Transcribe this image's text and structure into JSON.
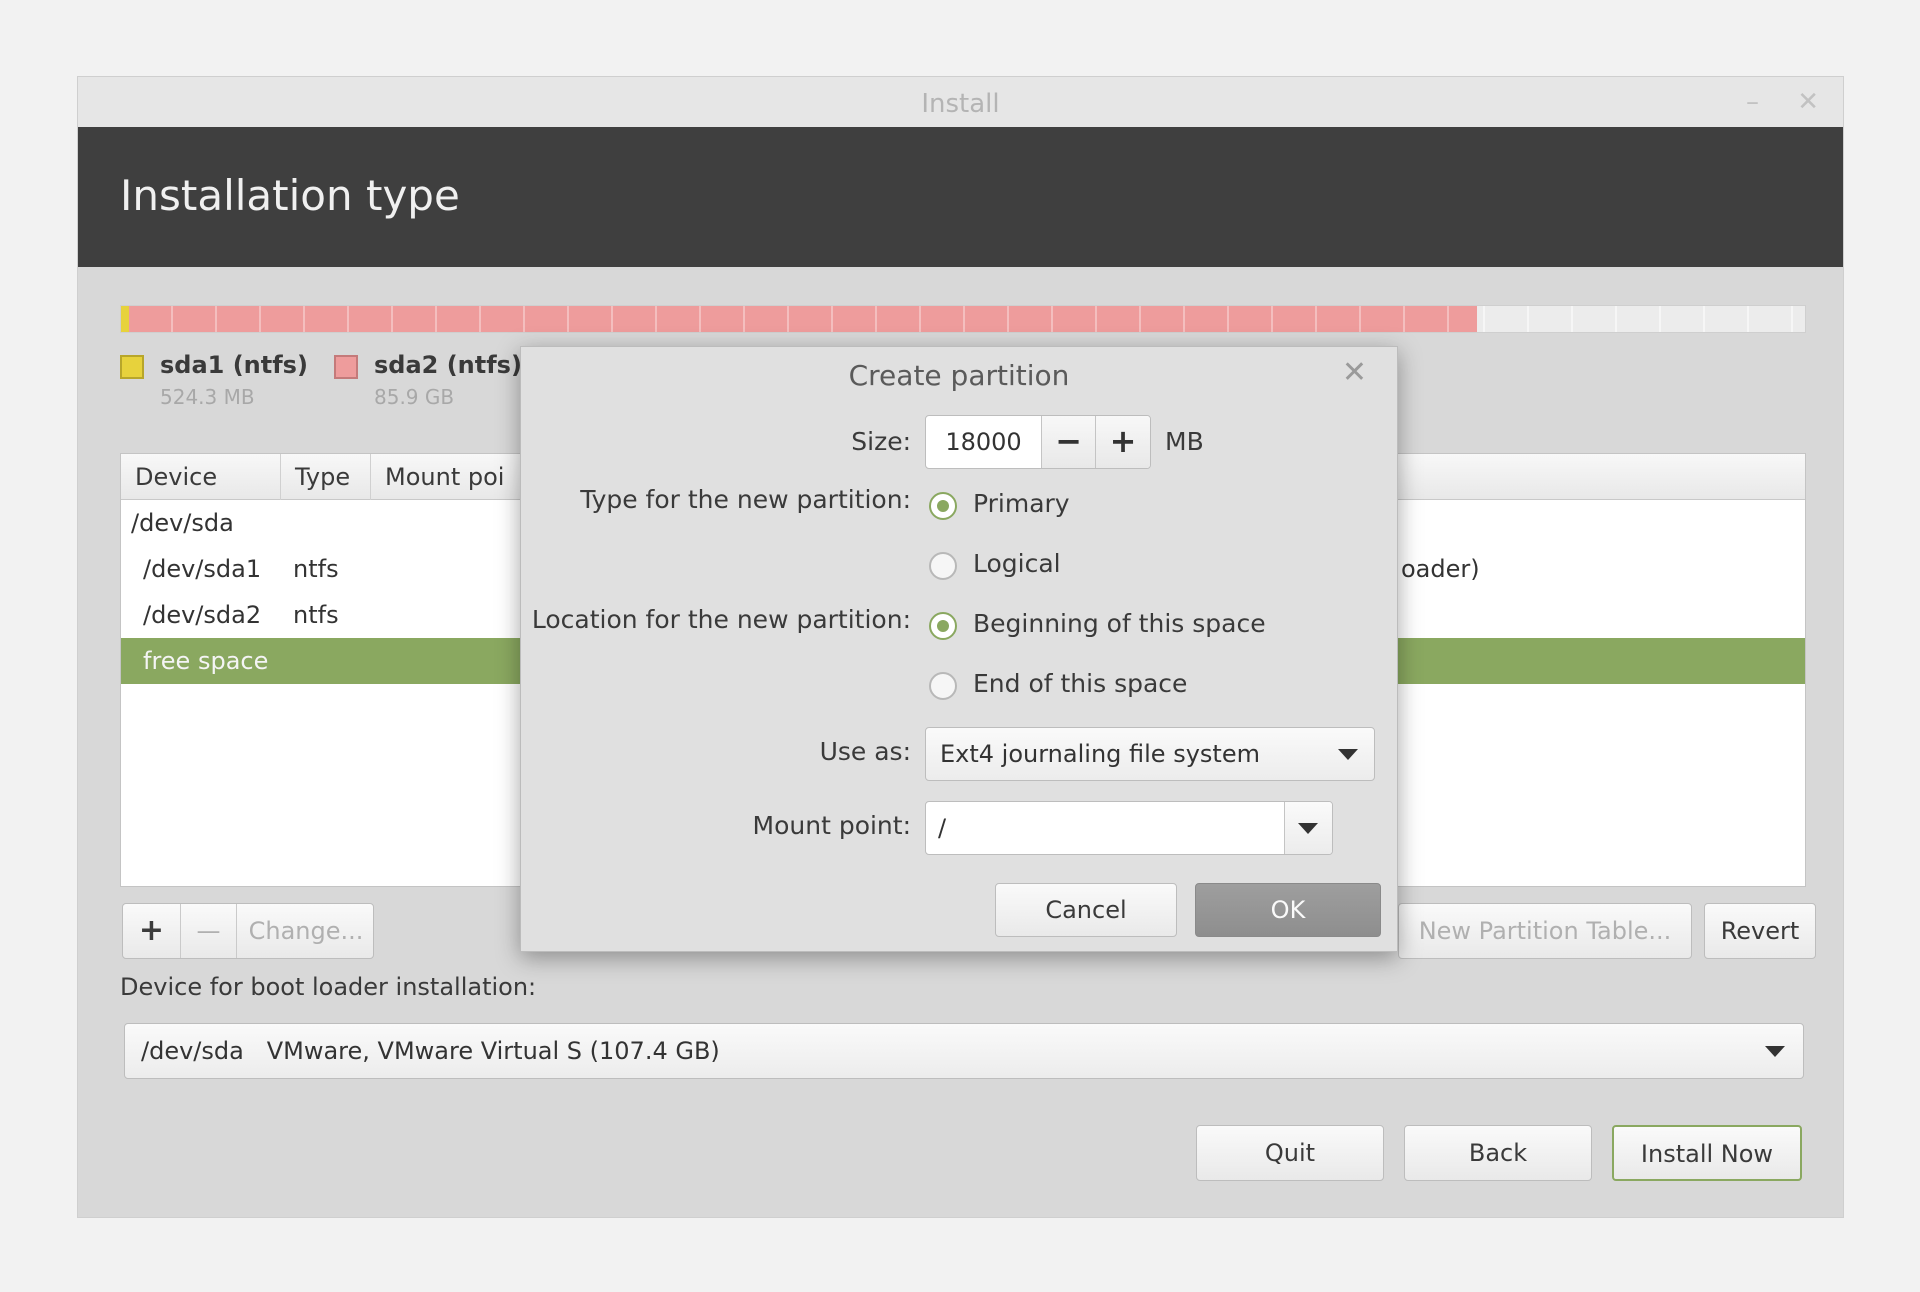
{
  "window": {
    "title": "Install",
    "minimize_glyph": "–",
    "close_glyph": "✕",
    "heading": "Installation type"
  },
  "disk_bar": {
    "segments": [
      {
        "name": "sda1 (ntfs)",
        "color": "#e7d23c",
        "fraction": 0.005
      },
      {
        "name": "sda2 (ntfs)",
        "color": "#ee9c9c",
        "fraction": 0.8
      },
      {
        "name": "free space",
        "color": "#ececec",
        "fraction": 0.195
      }
    ]
  },
  "legend": [
    {
      "name": "sda1 (ntfs)",
      "size": "524.3 MB",
      "color": "#e7d23c"
    },
    {
      "name": "sda2 (ntfs)",
      "size": "85.9 GB",
      "color": "#ee9c9c"
    }
  ],
  "partition_table": {
    "columns": [
      "Device",
      "Type",
      "Mount poi"
    ],
    "rows": [
      {
        "device": "/dev/sda",
        "type": "",
        "tail": ""
      },
      {
        "device": "/dev/sda1",
        "type": "ntfs",
        "tail": "oader)"
      },
      {
        "device": "/dev/sda2",
        "type": "ntfs",
        "tail": ""
      },
      {
        "device": "free space",
        "type": "",
        "tail": "",
        "selected": true
      }
    ]
  },
  "toolbar": {
    "add_label": "+",
    "remove_label": "—",
    "change_label": "Change...",
    "new_table_label": "New Partition Table...",
    "revert_label": "Revert"
  },
  "boot_loader": {
    "label": "Device for boot loader installation:",
    "value": "/dev/sda   VMware, VMware Virtual S (107.4 GB)"
  },
  "footer": {
    "quit_label": "Quit",
    "back_label": "Back",
    "install_label": "Install Now"
  },
  "dialog": {
    "title": "Create partition",
    "close_glyph": "✕",
    "size_label": "Size:",
    "size_value": "18000",
    "size_unit": "MB",
    "minus_glyph": "−",
    "plus_glyph": "+",
    "type_label": "Type for the new partition:",
    "type_options": [
      "Primary",
      "Logical"
    ],
    "type_selected": "Primary",
    "location_label": "Location for the new partition:",
    "location_options": [
      "Beginning of this space",
      "End of this space"
    ],
    "location_selected": "Beginning of this space",
    "use_as_label": "Use as:",
    "use_as_value": "Ext4 journaling file system",
    "mount_label": "Mount point:",
    "mount_value": "/",
    "cancel_label": "Cancel",
    "ok_label": "OK",
    "accent_color": "#8aa860"
  }
}
